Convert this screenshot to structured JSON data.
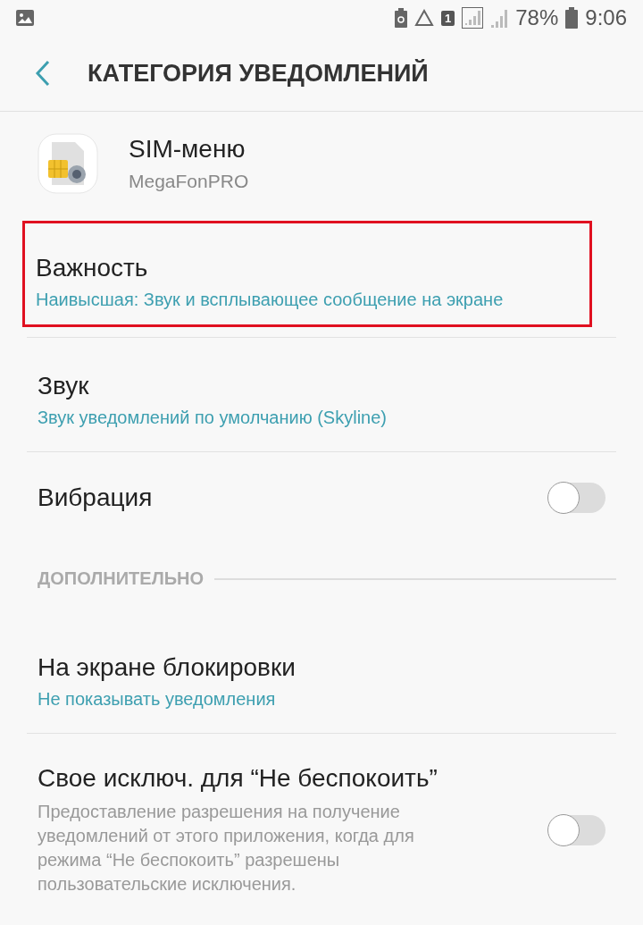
{
  "status_bar": {
    "battery": "78%",
    "time": "9:06",
    "sim_badge": "1"
  },
  "header": {
    "title": "КАТЕГОРИЯ УВЕДОМЛЕНИЙ"
  },
  "app": {
    "name": "SIM-меню",
    "subtitle": "MegaFonPRO"
  },
  "items": [
    {
      "kind": "link",
      "title": "Важность",
      "summary": "Наивысшая: Звук и всплывающее сообщение на экране",
      "highlighted": true
    },
    {
      "kind": "link",
      "title": "Звук",
      "summary": "Звук уведомлений по умолчанию (Skyline)",
      "highlighted": false
    },
    {
      "kind": "toggle",
      "title": "Вибрация",
      "on": false
    },
    {
      "kind": "section",
      "title": "ДОПОЛНИТЕЛЬНО"
    },
    {
      "kind": "link",
      "title": "На экране блокировки",
      "summary": "Не показывать уведомления",
      "highlighted": false
    },
    {
      "kind": "toggle",
      "title": "Свое исключ. для “Не беспокоить”",
      "description": "Предоставление разрешения на получение уведомлений от этого приложения, когда для режима “Не беспокоить” разрешены пользовательские исключения.",
      "on": false
    }
  ]
}
